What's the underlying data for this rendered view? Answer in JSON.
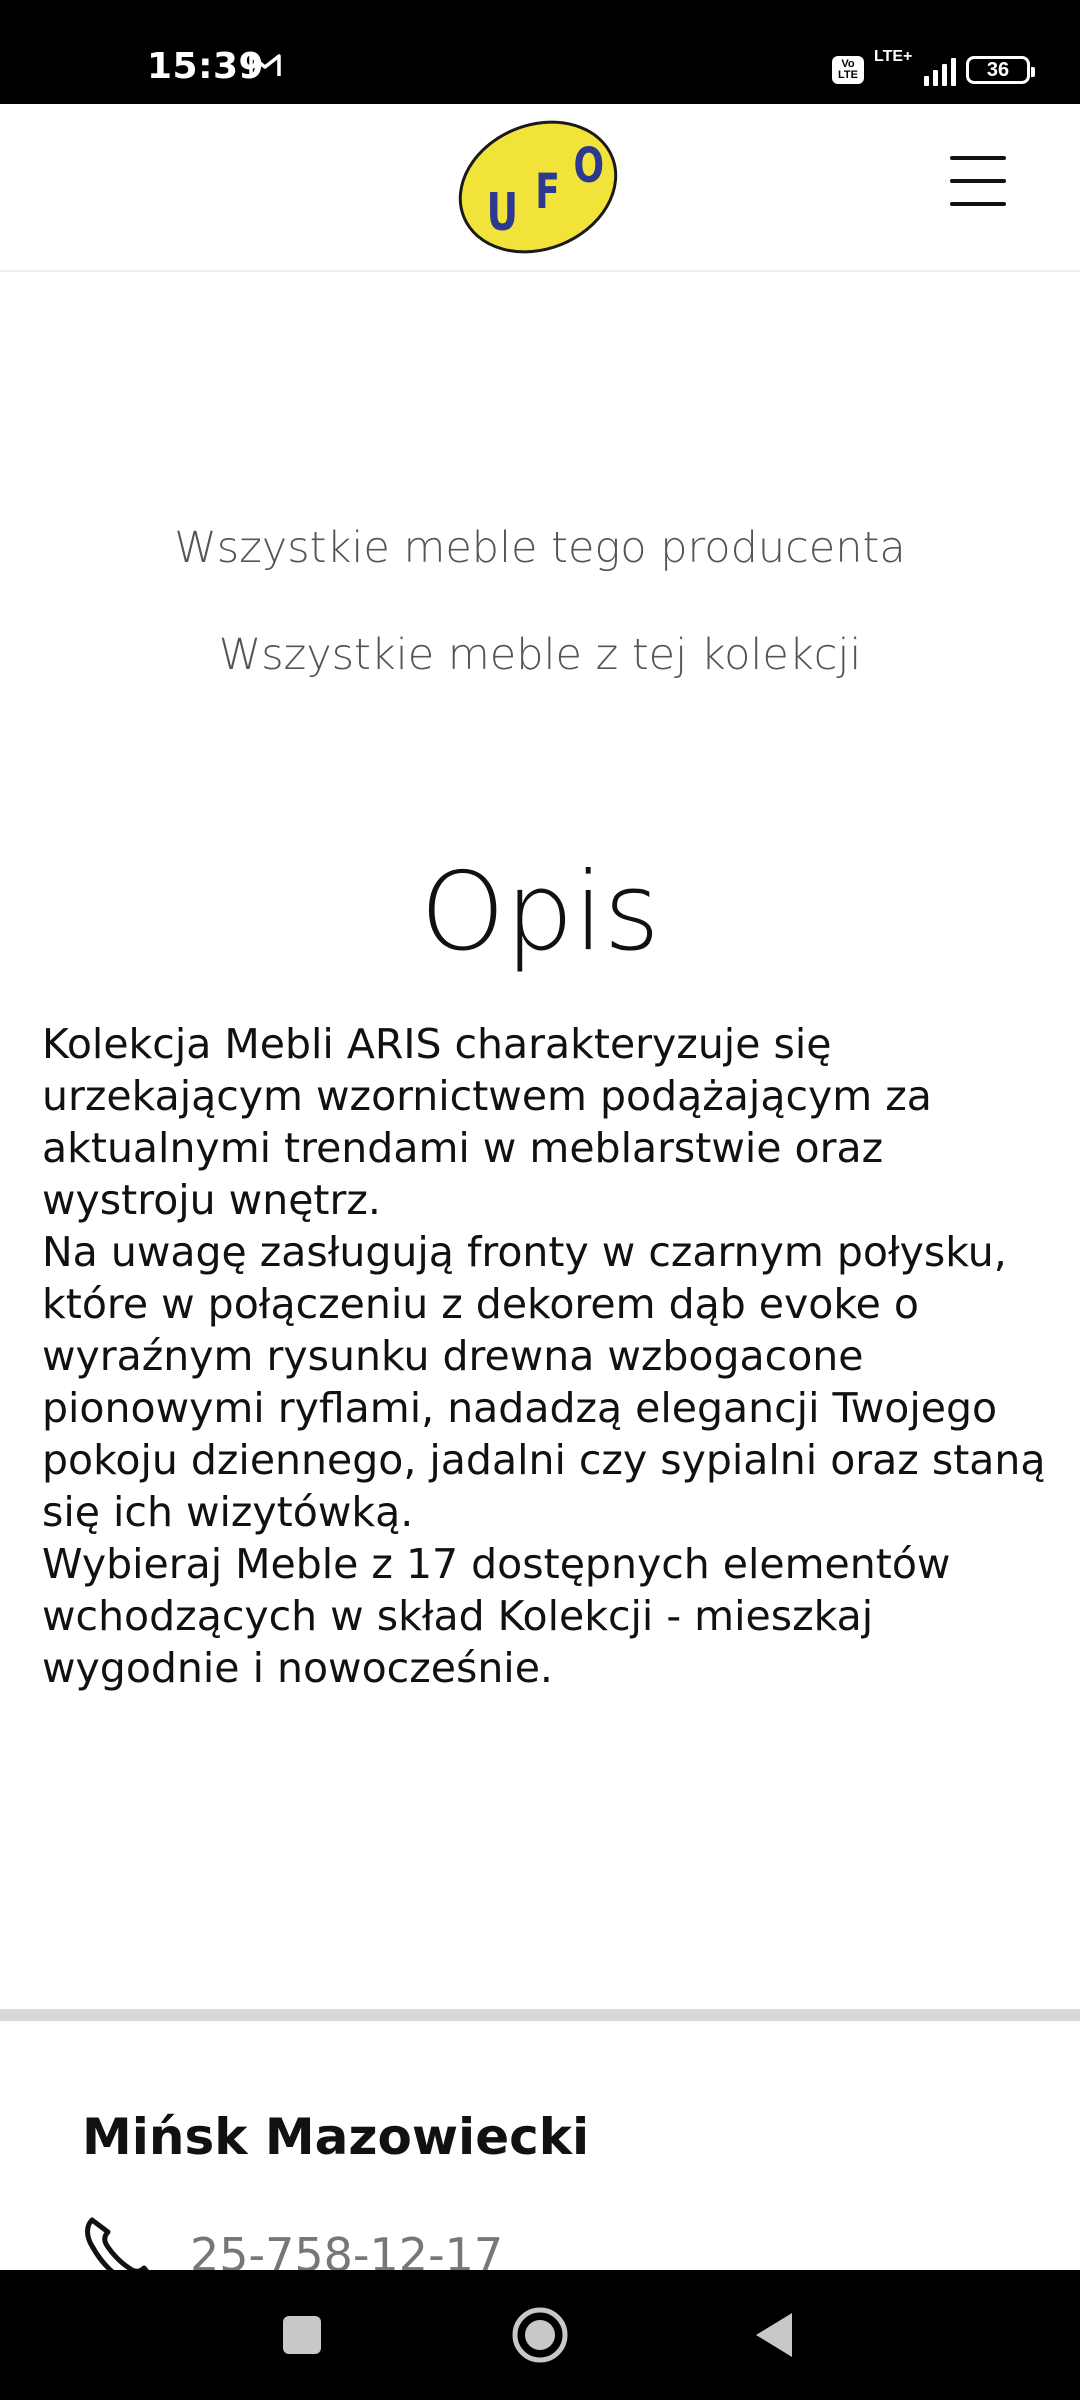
{
  "status_bar": {
    "time": "15:39",
    "battery": "36",
    "network": "LTE+",
    "volte": "Vo LTE"
  },
  "header": {
    "logo_text": "UFO",
    "logo_color": "#f2e33a",
    "logo_letter_color": "#2b3990"
  },
  "links": {
    "producer": "Wszystkie meble tego producenta",
    "collection": "Wszystkie meble z tej kolekcji"
  },
  "description": {
    "title": "Opis",
    "paragraphs": [
      "Kolekcja Mebli ARIS charakteryzuje się urzekającym wzornictwem podążającym za aktualnymi trendami w meblarstwie oraz wystroju wnętrz.",
      "Na uwagę zasługują fronty w czarnym połysku, które w połączeniu z dekorem dąb evoke o wyraźnym rysunku drewna wzbogacone pionowymi ryflami, nadadzą elegancji Twojego pokoju dziennego, jadalni czy sypialni oraz staną się ich wizytówką.",
      "Wybieraj Meble z 17 dostępnych elementów wchodzących w skład Kolekcji - mieszkaj wygodnie i nowocześnie."
    ]
  },
  "footer": {
    "store_name": "Mińsk Mazowiecki",
    "phone": "25-758-12-17"
  }
}
